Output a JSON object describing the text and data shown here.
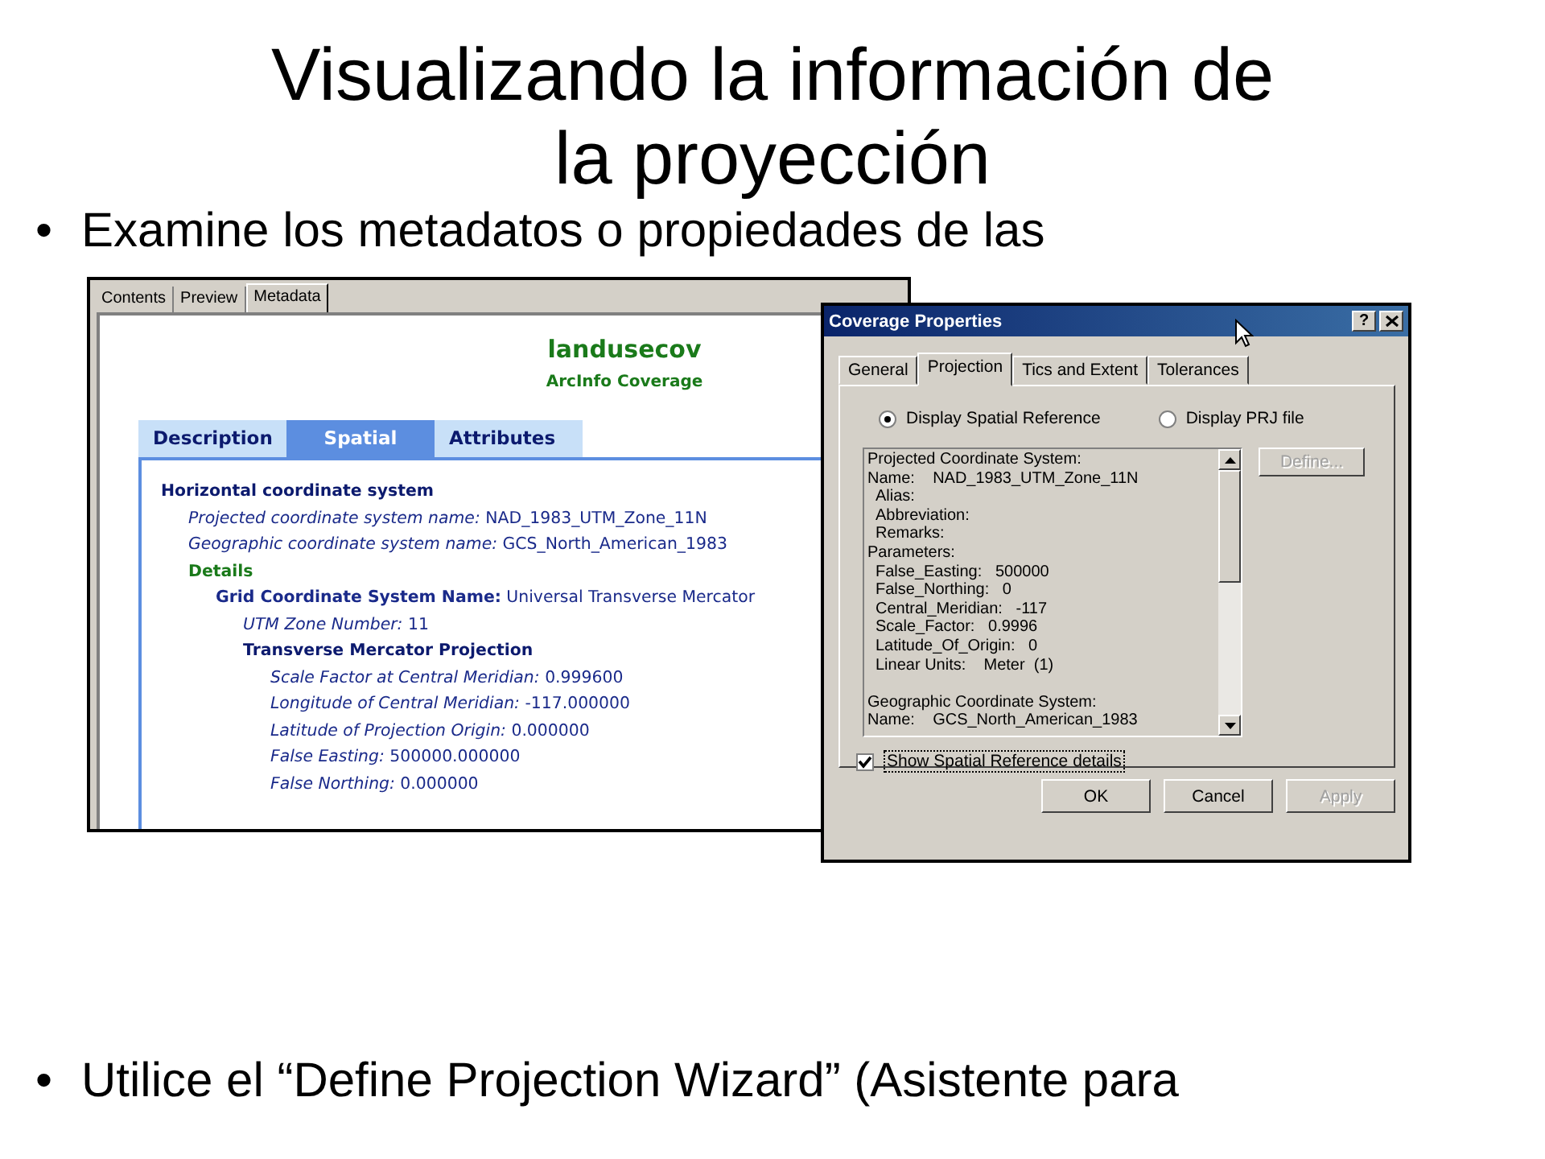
{
  "slide": {
    "title": "Visualizando la información de la proyección",
    "bullets": [
      {
        "marker": "•",
        "text": "Examine los metadatos o propiedades de las"
      },
      {
        "marker": "•",
        "text": "Utilice el “Define Projection Wizard” (Asistente para"
      }
    ]
  },
  "metadata_window": {
    "tabs": [
      {
        "label": "Contents",
        "selected": false
      },
      {
        "label": "Preview",
        "selected": false
      },
      {
        "label": "Metadata",
        "selected": true
      }
    ],
    "title": "landusecov",
    "subtitle": "ArcInfo Coverage",
    "page_tabs": [
      {
        "label": "Description",
        "selected": false
      },
      {
        "label": "Spatial",
        "selected": true
      },
      {
        "label": "Attributes",
        "selected": false
      }
    ],
    "tree": [
      {
        "kind": "heading",
        "text": "Horizontal coordinate system",
        "children": [
          {
            "kind": "field",
            "label": "Projected coordinate system name:",
            "value": "NAD_1983_UTM_Zone_11N"
          },
          {
            "kind": "field",
            "label": "Geographic coordinate system name:",
            "value": "GCS_North_American_1983"
          },
          {
            "kind": "section",
            "text": "Details",
            "children": [
              {
                "kind": "bold-field",
                "label": "Grid Coordinate System Name:",
                "value": "Universal Transverse Mercator",
                "children": [
                  {
                    "kind": "field",
                    "label": "UTM Zone Number:",
                    "value": "11"
                  },
                  {
                    "kind": "heading",
                    "text": "Transverse Mercator Projection",
                    "children": [
                      {
                        "kind": "field",
                        "label": "Scale Factor at Central Meridian:",
                        "value": "0.999600"
                      },
                      {
                        "kind": "field",
                        "label": "Longitude of Central Meridian:",
                        "value": "-117.000000"
                      },
                      {
                        "kind": "field",
                        "label": "Latitude of Projection Origin:",
                        "value": "0.000000"
                      },
                      {
                        "kind": "field",
                        "label": "False Easting:",
                        "value": "500000.000000"
                      },
                      {
                        "kind": "field",
                        "label": "False Northing:",
                        "value": "0.000000"
                      }
                    ]
                  }
                ]
              }
            ]
          }
        ]
      }
    ]
  },
  "dialog": {
    "title": "Coverage Properties",
    "help_button": "?",
    "tabs": [
      {
        "label": "General",
        "selected": false
      },
      {
        "label": "Projection",
        "selected": true
      },
      {
        "label": "Tics and Extent",
        "selected": false
      },
      {
        "label": "Tolerances",
        "selected": false
      }
    ],
    "radios": [
      {
        "label": "Display Spatial Reference",
        "selected": true
      },
      {
        "label": "Display PRJ file",
        "selected": false
      }
    ],
    "list": [
      {
        "kind": "header",
        "text": "Projected Coordinate System:"
      },
      {
        "kind": "line",
        "text": "Name:    NAD_1983_UTM_Zone_11N",
        "children": [
          {
            "kind": "line",
            "text": "Alias:"
          },
          {
            "kind": "line",
            "text": "Abbreviation:"
          },
          {
            "kind": "line",
            "text": "Remarks:"
          }
        ]
      },
      {
        "kind": "line",
        "text": "Parameters:",
        "children": [
          {
            "kind": "line",
            "text": "False_Easting:   500000"
          },
          {
            "kind": "line",
            "text": "False_Northing:   0"
          },
          {
            "kind": "line",
            "text": "Central_Meridian:   -117"
          },
          {
            "kind": "line",
            "text": "Scale_Factor:   0.9996"
          },
          {
            "kind": "line",
            "text": "Latitude_Of_Origin:   0"
          },
          {
            "kind": "line",
            "text": "Linear Units:    Meter  (1)"
          }
        ]
      },
      {
        "kind": "header",
        "text": "Geographic Coordinate System:"
      },
      {
        "kind": "line",
        "text": "Name:    GCS_North_American_1983"
      }
    ],
    "define_button": {
      "label": "Define...",
      "disabled": true
    },
    "checkbox": {
      "label": "Show Spatial Reference details",
      "checked": true
    },
    "buttons": [
      {
        "label": "OK",
        "disabled": false
      },
      {
        "label": "Cancel",
        "disabled": false
      },
      {
        "label": "Apply",
        "disabled": true
      }
    ]
  }
}
